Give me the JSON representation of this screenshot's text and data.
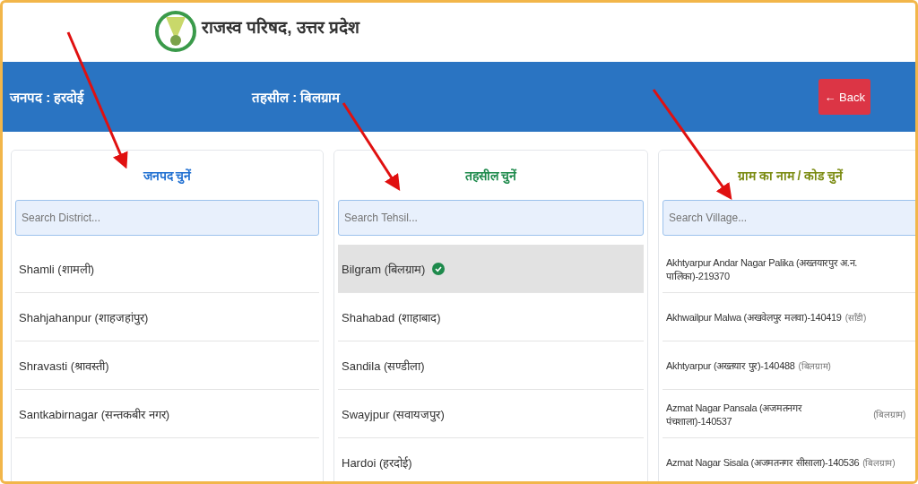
{
  "header": {
    "title": "राजस्व परिषद, उत्तर प्रदेश"
  },
  "info_bar": {
    "district": "जनपद : हरदोई",
    "tehsil": "तहसील : बिलग्राम",
    "back_button": "← Back"
  },
  "panels": [
    {
      "kind": "district",
      "title": "जनपद चुनें",
      "color": "#1f6fd1",
      "search": {
        "placeholder": "Search District..."
      },
      "items": [
        {
          "name": "Shamli (शामली)",
          "selected": false
        },
        {
          "name": "Shahjahanpur (शाहजहांपुर)",
          "selected": false
        },
        {
          "name": "Shravasti (श्रावस्ती)",
          "selected": false
        },
        {
          "name": "Santkabirnagar (सन्तकबीर नगर)",
          "selected": false
        }
      ]
    },
    {
      "kind": "tehsil",
      "title": "तहसील चुनें",
      "color": "#1e8a4c",
      "search": {
        "placeholder": "Search Tehsil..."
      },
      "items": [
        {
          "name": "Bilgram (बिलग्राम)",
          "selected": true
        },
        {
          "name": "Shahabad (शाहाबाद)",
          "selected": false
        },
        {
          "name": "Sandila (सण्डीला)",
          "selected": false
        },
        {
          "name": "Swayjpur (सवायजपुर)",
          "selected": false
        },
        {
          "name": "Hardoi (हरदोई)",
          "selected": false
        }
      ]
    },
    {
      "kind": "village",
      "title": "ग्राम का नाम / कोड चुनें",
      "color": "#7a8a10",
      "search": {
        "placeholder": "Search Village..."
      },
      "items": [
        {
          "name": "Akhtyarpur Andar Nagar Palika (अख्तयारपुर अ.न. पालिका)-219370",
          "selected": false
        },
        {
          "name": "Akhwailpur Malwa (अखवेलपुर मलवा)-140419",
          "tehsil": "(साँडी)",
          "selected": false
        },
        {
          "name": "Akhtyarpur (अख्तयार पुर)-140488",
          "tehsil": "(बिलग्राम)",
          "selected": false
        },
        {
          "name": "Azmat Nagar Pansala (अजमतनगर पंचशाला)-140537",
          "tehsil": "(बिलग्राम)",
          "selected": false
        },
        {
          "name": "Azmat Nagar Sisala (अजमतनगर सीसाला)-140536",
          "tehsil": "(बिलग्राम)",
          "selected": false
        }
      ]
    }
  ]
}
